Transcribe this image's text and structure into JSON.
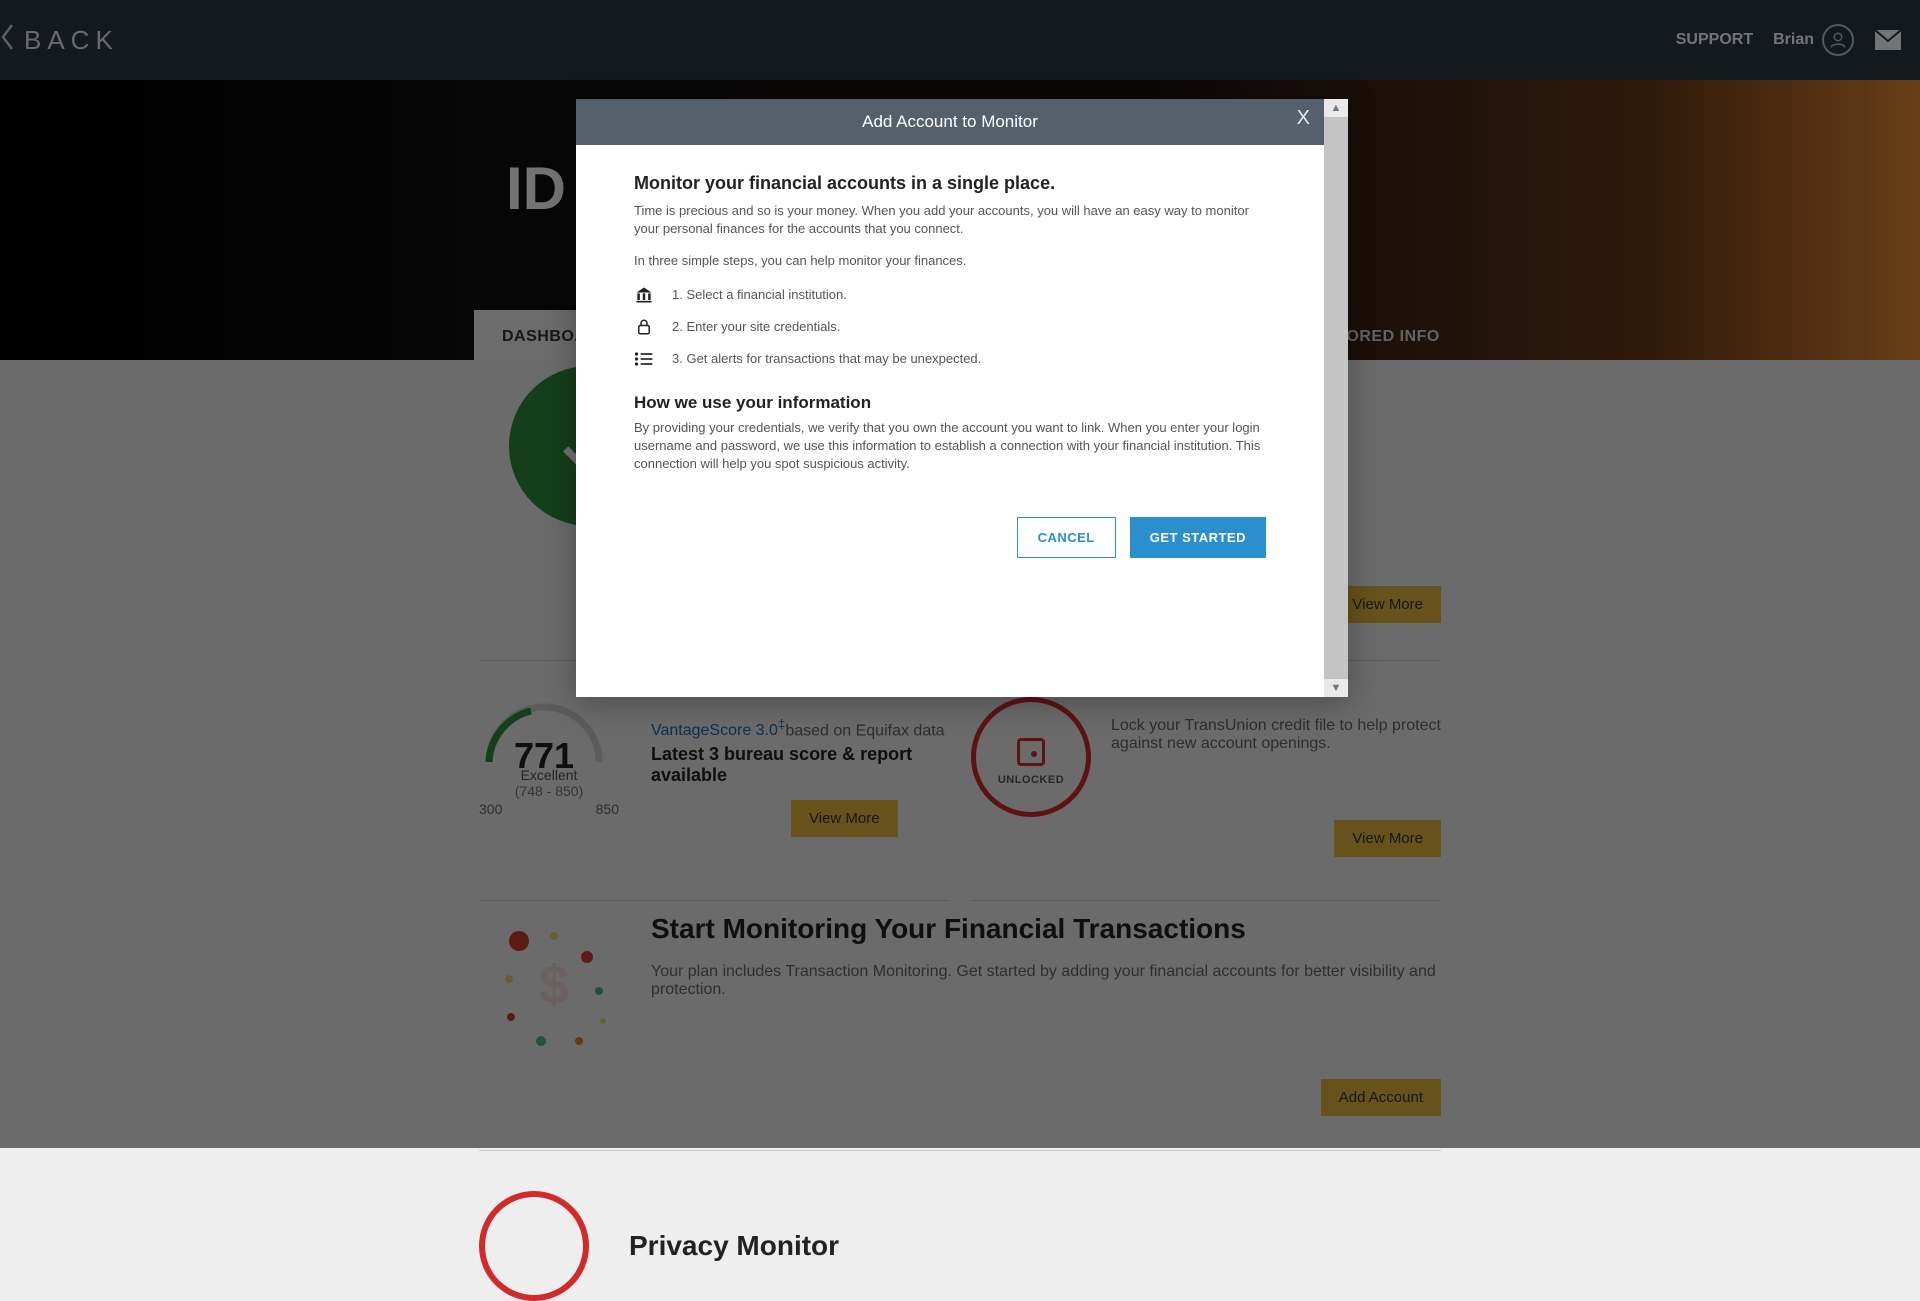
{
  "header": {
    "back": "BACK",
    "support": "SUPPORT",
    "user": "Brian"
  },
  "hero": {
    "title": "ID T"
  },
  "tabs": {
    "dashboard": "DASHBOARD",
    "monitored": "ONITORED INFO"
  },
  "alerts": {
    "viewMore": "View More"
  },
  "score": {
    "value": "771",
    "ratingLabel": "Excellent",
    "range": "(748 - 850)",
    "min": "300",
    "max": "850",
    "provider": "VantageScore 3.0",
    "sup": "‡",
    "basedOn": "based on Equifax data",
    "latest": "Latest 3 bureau score & report available",
    "viewMore": "View More"
  },
  "lock": {
    "status": "UNLOCKED",
    "desc": "Lock your TransUnion credit file to help protect against new account openings.",
    "viewMore": "View More"
  },
  "monitor": {
    "title": "Start Monitoring Your Financial Transactions",
    "sub": "Your plan includes Transaction Monitoring. Get started by adding your financial accounts for better visibility and protection.",
    "addAccount": "Add Account"
  },
  "privacy": {
    "title": "Privacy Monitor"
  },
  "modal": {
    "title": "Add Account to Monitor",
    "h1": "Monitor your financial accounts in a single place.",
    "p1": "Time is precious and so is your money. When you add your accounts, you will have an easy way to monitor your personal finances for the accounts that you connect.",
    "p2": "In three simple steps, you can help monitor your finances.",
    "step1": "1. Select a financial institution.",
    "step2": "2. Enter your site credentials.",
    "step3": "3. Get alerts for transactions that may be unexpected.",
    "howTitle": "How we use your information",
    "howBody": "By providing your credentials, we verify that you own the account you want to link. When you enter your login username and password, we use this information to establish a connection with your financial institution. This connection will help you spot suspicious activity.",
    "cancel": "CANCEL",
    "getStarted": "GET STARTED"
  }
}
